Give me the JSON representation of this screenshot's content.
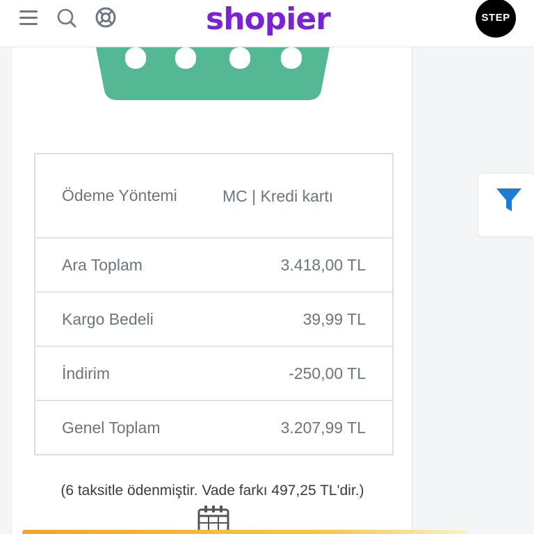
{
  "header": {
    "logo": "shopier",
    "avatar_text": "STEP",
    "icons": [
      "hamburger-menu-icon",
      "search-icon",
      "support-lifebuoy-icon"
    ]
  },
  "summary": {
    "rows": [
      {
        "label": "Ödeme Yöntemi",
        "value": "MC | Kredi kartı"
      },
      {
        "label": "Ara Toplam",
        "value": "3.418,00 TL"
      },
      {
        "label": "Kargo Bedeli",
        "value": "39,99 TL"
      },
      {
        "label": "İndirim",
        "value": "-250,00 TL"
      },
      {
        "label": "Genel Toplam",
        "value": "3.207,99 TL"
      }
    ]
  },
  "installment_note": "(6 taksitle ödenmiştir. Vade farkı 497,25 TL'dir.)",
  "colors": {
    "brand": "#7b22d6",
    "basket": "#55b894",
    "filter": "#1a7fd4",
    "text": "#6c757d"
  }
}
